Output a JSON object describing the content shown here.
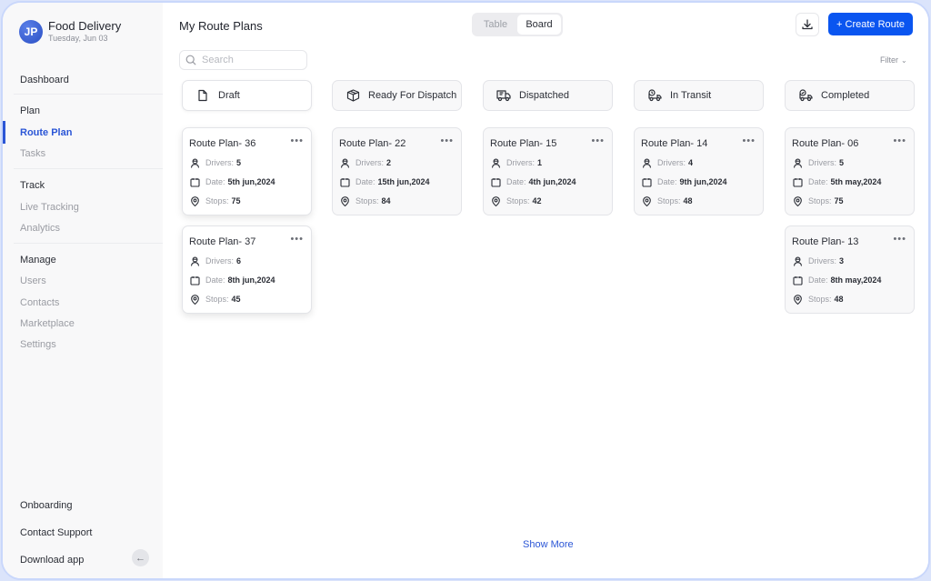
{
  "profile": {
    "initials": "JP",
    "app_name": "Food Delivery",
    "date": "Tuesday, Jun 03"
  },
  "sidebar": {
    "dashboard": "Dashboard",
    "plan_section": "Plan",
    "plan_items": [
      "Route Plan",
      "Tasks"
    ],
    "track_section": "Track",
    "track_items": [
      "Live Tracking",
      "Analytics"
    ],
    "manage_section": "Manage",
    "manage_items": [
      "Users",
      "Contacts",
      "Marketplace",
      "Settings"
    ],
    "active_item": "Route Plan",
    "bottom_items": [
      "Onboarding",
      "Contact Support",
      "Download app"
    ],
    "collapse_icon": "arrow-left-icon"
  },
  "header": {
    "title": "My Route Plans",
    "view_toggle": {
      "options": [
        "Table",
        "Board"
      ],
      "selected": "Board"
    },
    "download_icon": "download-icon",
    "create_button": "+ Create Route"
  },
  "search": {
    "placeholder": "Search",
    "value": ""
  },
  "filter": {
    "label": "Filter"
  },
  "labels": {
    "drivers": "Drivers:",
    "date": "Date:",
    "stops": "Stops:"
  },
  "columns": [
    {
      "title": "Draft",
      "icon": "document-icon",
      "cards": [
        {
          "title": "Route Plan- 36",
          "drivers": "5",
          "date": "5th jun,2024",
          "stops": "75"
        },
        {
          "title": "Route Plan- 37",
          "drivers": "6",
          "date": "8th jun,2024",
          "stops": "45"
        }
      ]
    },
    {
      "title": "Ready For Dispatch",
      "icon": "package-icon",
      "cards": [
        {
          "title": "Route Plan- 22",
          "drivers": "2",
          "date": "15th jun,2024",
          "stops": "84"
        }
      ]
    },
    {
      "title": "Dispatched",
      "icon": "truck-icon",
      "cards": [
        {
          "title": "Route Plan- 15",
          "drivers": "1",
          "date": "4th jun,2024",
          "stops": "42"
        }
      ]
    },
    {
      "title": "In Transit",
      "icon": "truck-clock-icon",
      "cards": [
        {
          "title": "Route Plan- 14",
          "drivers": "4",
          "date": "9th jun,2024",
          "stops": "48"
        }
      ]
    },
    {
      "title": "Completed",
      "icon": "truck-check-icon",
      "cards": [
        {
          "title": "Route Plan- 06",
          "drivers": "5",
          "date": "5th may,2024",
          "stops": "75"
        },
        {
          "title": "Route Plan- 13",
          "drivers": "3",
          "date": "8th may,2024",
          "stops": "48"
        }
      ]
    }
  ],
  "show_more": "Show More",
  "colors": {
    "accent": "#0a55f0",
    "active_nav": "#2b56d6",
    "frame_border": "#c9d7fb"
  }
}
